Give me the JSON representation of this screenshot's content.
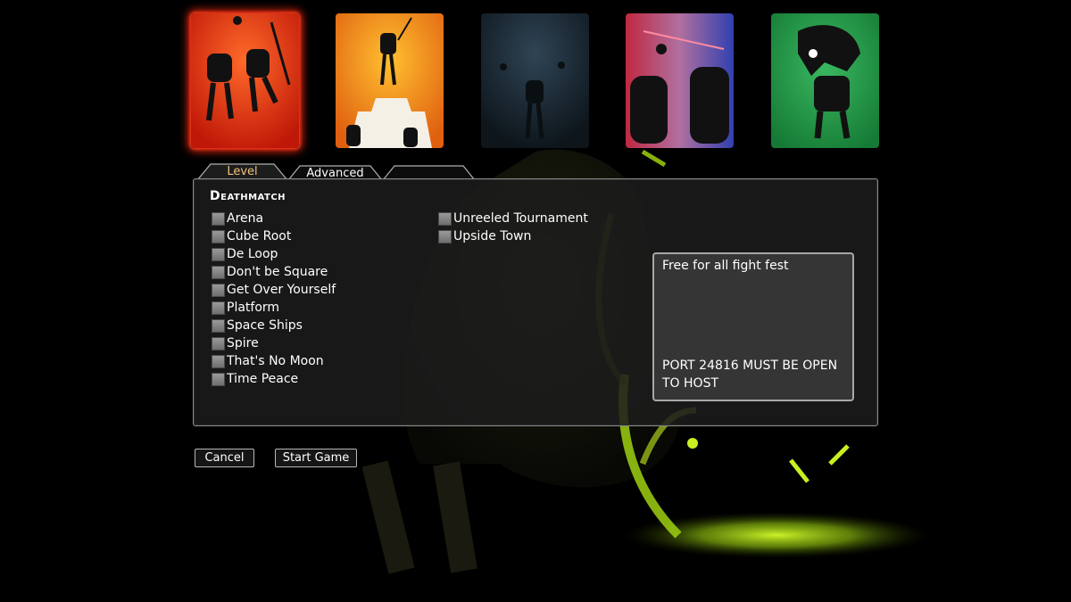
{
  "mode_cards": [
    {
      "name": "deathmatch-card",
      "icon": "two-robots-fighting-icon",
      "color": "#e03a14",
      "selected": true
    },
    {
      "name": "king-of-hill-card",
      "icon": "robot-on-pyramid-icon",
      "color": "#f08a10",
      "selected": false
    },
    {
      "name": "night-battle-card",
      "icon": "robots-in-dark-icon",
      "color": "#1c2a35",
      "selected": false
    },
    {
      "name": "team-battle-card",
      "icon": "robots-red-blue-icon",
      "color": "#a03a70",
      "selected": false
    },
    {
      "name": "monster-card",
      "icon": "dinosaur-robot-icon",
      "color": "#2a9a4a",
      "selected": false
    }
  ],
  "tabs": [
    {
      "label": "Level",
      "active": true
    },
    {
      "label": "Advanced",
      "active": false
    },
    {
      "label": "",
      "active": false
    }
  ],
  "section_title": "Deathmatch",
  "levels_col1": [
    "Arena",
    "Cube Root",
    "De Loop",
    "Don't be Square",
    "Get Over Yourself",
    "Platform",
    "Space Ships",
    "Spire",
    "That's No Moon",
    "Time Peace"
  ],
  "levels_col2": [
    "Unreeled Tournament",
    "Upside Town"
  ],
  "description": "Free for all fight fest",
  "port_notice": "PORT 24816 MUST BE OPEN TO HOST",
  "buttons": {
    "cancel": "Cancel",
    "start": "Start Game"
  },
  "colors": {
    "accent_glow": "#c8f020",
    "selected_card_glow": "#ff2a10",
    "active_tab_text": "#f2c27a"
  }
}
